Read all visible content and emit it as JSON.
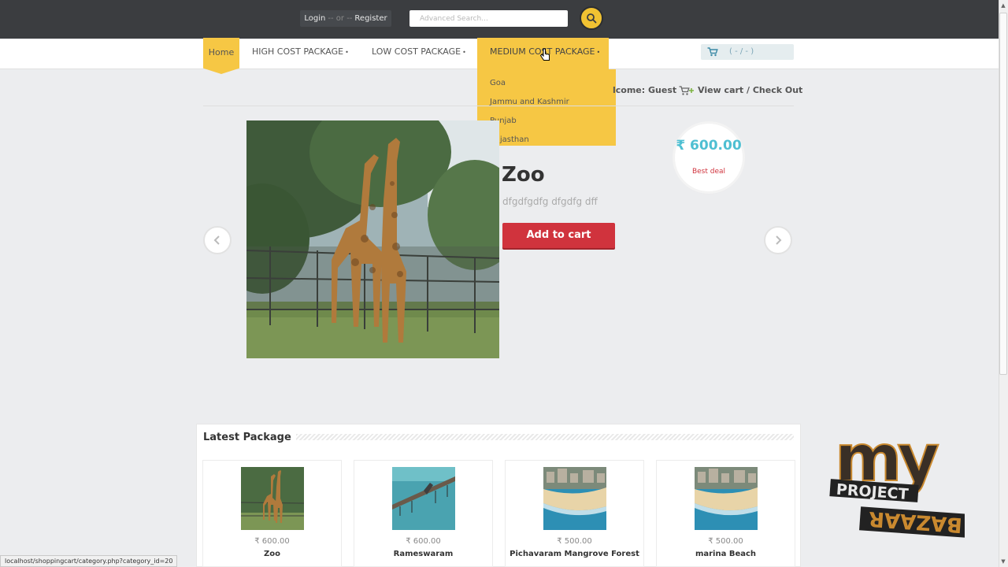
{
  "header": {
    "login_label": "Login",
    "or_label": "-- or --",
    "register_label": "Register",
    "search_placeholder": "Advanced Search..."
  },
  "nav": {
    "home": "Home",
    "high": "HIGH COST PACKAGE",
    "low": "LOW COST PACKAGE",
    "medium": "MEDIUM COST PACKAGE",
    "bullet": "•",
    "dropdown": [
      "Goa",
      "Jammu and Kashmir",
      "Punjab",
      "Rajasthan"
    ],
    "cart_summary": "( - / - )"
  },
  "account": {
    "welcome": "lcome: Guest",
    "view_cart": "View cart / Check Out"
  },
  "slider": {
    "title": "Zoo",
    "description": "dfgdfgdfg dfgdfg dff",
    "add_to_cart": "Add to cart",
    "price": "₹ 600.00",
    "price_label": "Best deal"
  },
  "latest": {
    "title": "Latest Package",
    "items": [
      {
        "price": "₹ 600.00",
        "name": "Zoo"
      },
      {
        "price": "₹ 600.00",
        "name": "Rameswaram"
      },
      {
        "price": "₹ 500.00",
        "name": "Pichavaram Mangrove Forest"
      },
      {
        "price": "₹ 500.00",
        "name": "marina Beach"
      }
    ]
  },
  "statusbar": {
    "url": "localhost/shoppingcart/category.php?category_id=20"
  },
  "watermark": {
    "text_top": "my",
    "text_mid": "PROJECT",
    "text_bottom": "BAZAAR"
  },
  "colors": {
    "accent_yellow": "#f6c744",
    "button_red": "#d0333d",
    "price_blue": "#4ebfd2",
    "topbar": "#3b3d40"
  }
}
